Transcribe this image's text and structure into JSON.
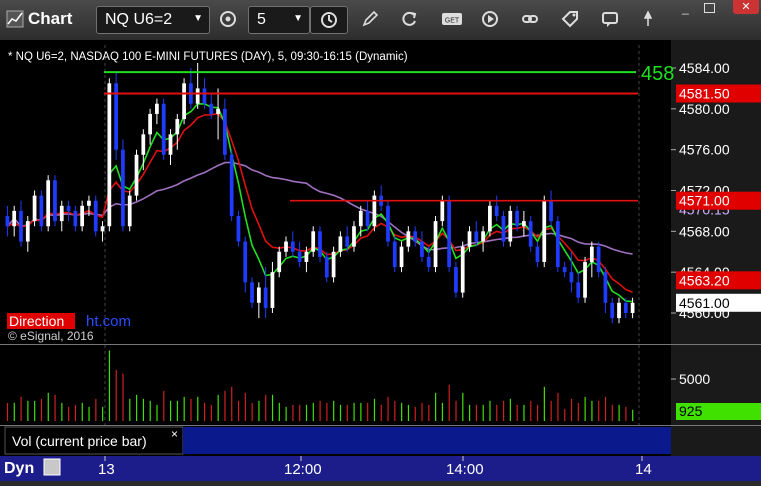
{
  "window": {
    "title": "Chart"
  },
  "toolbar": {
    "symbol": "NQ U6=2",
    "interval": "5",
    "icons": [
      "settings-icon",
      "clock-icon",
      "pencil-icon",
      "refresh-icon",
      "get-icon",
      "play-icon",
      "link-icon",
      "comment-icon",
      "tag-icon"
    ]
  },
  "chart": {
    "header": "* NQ U6=2, NASDAQ 100 E-MINI FUTURES (DAY), 5, 09:30-16:15 (Dynamic)",
    "watermark_red": "Direction",
    "watermark_blue": "ht.com",
    "copyright": "© eSignal, 2016",
    "green_label_partial": "458",
    "price_ticks": [
      "4584.00",
      "4580.00",
      "4576.00",
      "4572.00",
      "4568.00",
      "4564.00",
      "4560.00"
    ],
    "price_labels": {
      "red_top": "4581.50",
      "red_mid": "4571.00",
      "red_low": "4563.20",
      "last": "4561.00",
      "purple_partial": "4570.15"
    },
    "vol_ticks": [
      "5000"
    ],
    "vol_label": "925",
    "vol_title": "Vol (current price bar)",
    "vol_close": "×",
    "x_ticks": [
      "13",
      "12:00",
      "14:00",
      "14"
    ],
    "footer": "Dyn"
  },
  "colors": {
    "up": "#ffffff",
    "down": "#1f3bff",
    "ema_red": "#e01010",
    "ema_green": "#20e020",
    "sma_purple": "#a070c0",
    "label_red": "#e00000",
    "vol_green": "#40e000"
  },
  "chart_data": {
    "type": "candlestick",
    "ylim": [
      4558,
      4586
    ],
    "levels": {
      "green": 4583.6,
      "red_top": 4581.5,
      "red_mid": 4571.0
    },
    "candles": [
      [
        4569.5,
        4570.5,
        4567.5,
        4568.5
      ],
      [
        4568.5,
        4570.5,
        4567.5,
        4570.0
      ],
      [
        4570.0,
        4571.0,
        4566.5,
        4567.0
      ],
      [
        4567.0,
        4569.5,
        4566.0,
        4569.0
      ],
      [
        4569.0,
        4572.0,
        4568.5,
        4571.5
      ],
      [
        4571.5,
        4572.0,
        4568.0,
        4568.5
      ],
      [
        4568.5,
        4573.5,
        4568.0,
        4573.0
      ],
      [
        4573.0,
        4573.5,
        4568.5,
        4569.0
      ],
      [
        4569.0,
        4571.0,
        4568.0,
        4570.5
      ],
      [
        4570.5,
        4571.0,
        4569.0,
        4570.0
      ],
      [
        4570.0,
        4570.5,
        4568.0,
        4568.5
      ],
      [
        4568.5,
        4571.0,
        4568.0,
        4570.5
      ],
      [
        4570.5,
        4571.5,
        4569.5,
        4571.0
      ],
      [
        4571.0,
        4571.5,
        4567.5,
        4568.0
      ],
      [
        4568.0,
        4569.0,
        4567.0,
        4568.5
      ],
      [
        4568.5,
        4583.0,
        4568.0,
        4582.5
      ],
      [
        4582.5,
        4583.5,
        4575.0,
        4576.0
      ],
      [
        4576.0,
        4577.0,
        4568.0,
        4568.5
      ],
      [
        4568.5,
        4572.0,
        4568.0,
        4571.5
      ],
      [
        4571.5,
        4576.0,
        4571.0,
        4575.5
      ],
      [
        4575.5,
        4578.0,
        4574.0,
        4577.5
      ],
      [
        4577.5,
        4580.0,
        4576.5,
        4579.5
      ],
      [
        4579.5,
        4581.0,
        4578.5,
        4580.5
      ],
      [
        4580.5,
        4581.0,
        4575.0,
        4575.5
      ],
      [
        4575.5,
        4578.0,
        4574.5,
        4577.5
      ],
      [
        4577.5,
        4579.5,
        4576.0,
        4579.0
      ],
      [
        4579.0,
        4583.0,
        4578.5,
        4582.5
      ],
      [
        4582.5,
        4584.0,
        4580.0,
        4580.5
      ],
      [
        4580.5,
        4584.5,
        4580.0,
        4582.0
      ],
      [
        4582.0,
        4583.0,
        4580.0,
        4580.5
      ],
      [
        4580.5,
        4581.5,
        4579.0,
        4579.5
      ],
      [
        4579.5,
        4582.0,
        4577.0,
        4580.0
      ],
      [
        4580.0,
        4581.0,
        4575.0,
        4575.5
      ],
      [
        4575.5,
        4576.0,
        4569.0,
        4569.5
      ],
      [
        4569.5,
        4570.0,
        4566.5,
        4567.0
      ],
      [
        4567.0,
        4567.5,
        4562.0,
        4563.0
      ],
      [
        4563.0,
        4563.5,
        4560.5,
        4561.0
      ],
      [
        4561.0,
        4563.0,
        4559.5,
        4562.5
      ],
      [
        4562.5,
        4564.5,
        4559.5,
        4560.5
      ],
      [
        4560.5,
        4565.0,
        4560.0,
        4564.0
      ],
      [
        4564.0,
        4566.5,
        4563.5,
        4566.0
      ],
      [
        4566.0,
        4567.5,
        4565.5,
        4567.0
      ],
      [
        4567.0,
        4568.0,
        4565.5,
        4566.0
      ],
      [
        4566.0,
        4567.0,
        4564.5,
        4565.0
      ],
      [
        4565.0,
        4566.5,
        4564.0,
        4566.0
      ],
      [
        4566.0,
        4568.5,
        4565.5,
        4568.0
      ],
      [
        4568.0,
        4568.5,
        4565.0,
        4565.5
      ],
      [
        4565.5,
        4566.0,
        4563.0,
        4563.5
      ],
      [
        4563.5,
        4566.5,
        4563.0,
        4566.0
      ],
      [
        4566.0,
        4568.0,
        4565.5,
        4567.5
      ],
      [
        4567.5,
        4568.5,
        4566.0,
        4566.5
      ],
      [
        4566.5,
        4569.0,
        4566.0,
        4568.5
      ],
      [
        4568.5,
        4570.5,
        4567.5,
        4570.0
      ],
      [
        4570.0,
        4571.0,
        4568.0,
        4568.5
      ],
      [
        4568.5,
        4572.0,
        4568.0,
        4571.5
      ],
      [
        4571.5,
        4572.5,
        4570.0,
        4570.5
      ],
      [
        4570.5,
        4571.0,
        4566.5,
        4567.0
      ],
      [
        4567.0,
        4567.5,
        4564.0,
        4564.5
      ],
      [
        4564.5,
        4567.0,
        4564.0,
        4566.5
      ],
      [
        4566.5,
        4568.5,
        4566.0,
        4568.0
      ],
      [
        4568.0,
        4568.5,
        4566.5,
        4567.0
      ],
      [
        4567.0,
        4568.0,
        4565.0,
        4565.5
      ],
      [
        4565.5,
        4566.5,
        4564.0,
        4564.5
      ],
      [
        4564.5,
        4569.5,
        4564.0,
        4569.0
      ],
      [
        4569.0,
        4571.5,
        4568.5,
        4571.0
      ],
      [
        4571.0,
        4571.5,
        4564.0,
        4564.5
      ],
      [
        4564.5,
        4565.0,
        4561.5,
        4562.0
      ],
      [
        4562.0,
        4567.0,
        4561.5,
        4566.5
      ],
      [
        4566.5,
        4568.5,
        4566.0,
        4568.0
      ],
      [
        4568.0,
        4569.0,
        4566.5,
        4567.0
      ],
      [
        4567.0,
        4568.5,
        4566.0,
        4568.0
      ],
      [
        4568.0,
        4571.0,
        4567.5,
        4570.5
      ],
      [
        4570.5,
        4571.5,
        4569.0,
        4569.5
      ],
      [
        4569.5,
        4570.0,
        4566.5,
        4567.0
      ],
      [
        4567.0,
        4570.5,
        4566.5,
        4570.0
      ],
      [
        4570.0,
        4570.5,
        4568.0,
        4568.5
      ],
      [
        4568.5,
        4570.0,
        4567.5,
        4569.0
      ],
      [
        4569.0,
        4569.5,
        4566.0,
        4566.5
      ],
      [
        4566.5,
        4567.0,
        4564.5,
        4565.0
      ],
      [
        4565.0,
        4571.5,
        4564.5,
        4571.0
      ],
      [
        4571.0,
        4572.0,
        4568.5,
        4569.0
      ],
      [
        4569.0,
        4569.5,
        4564.0,
        4564.5
      ],
      [
        4564.5,
        4565.0,
        4563.5,
        4564.0
      ],
      [
        4564.0,
        4566.0,
        4562.0,
        4563.0
      ],
      [
        4563.0,
        4564.0,
        4561.0,
        4561.5
      ],
      [
        4561.5,
        4565.5,
        4561.0,
        4565.0
      ],
      [
        4565.0,
        4567.0,
        4563.5,
        4566.5
      ],
      [
        4566.5,
        4567.0,
        4563.5,
        4564.0
      ],
      [
        4564.0,
        4564.5,
        4560.0,
        4561.0
      ],
      [
        4561.0,
        4561.5,
        4559.0,
        4559.5
      ],
      [
        4559.5,
        4561.5,
        4559.0,
        4561.0
      ],
      [
        4561.0,
        4561.5,
        4559.5,
        4560.0
      ],
      [
        4560.0,
        4561.5,
        4559.5,
        4561.0
      ]
    ],
    "volume_ylim": [
      0,
      6000
    ]
  }
}
